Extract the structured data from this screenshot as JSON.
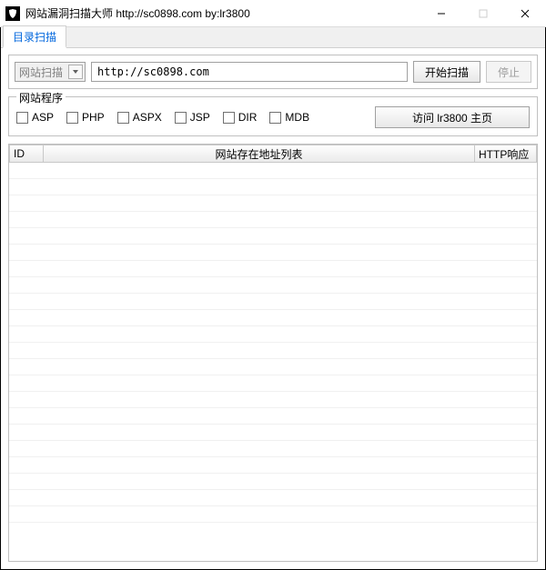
{
  "window": {
    "title": "网站漏洞扫描大师 http://sc0898.com by:lr3800"
  },
  "tab": {
    "label": "目录扫描"
  },
  "scan": {
    "combo_value": "网站扫描",
    "url_value": "http://sc0898.com",
    "start_label": "开始扫描",
    "stop_label": "停止"
  },
  "fieldset": {
    "legend": "网站程序",
    "checks": {
      "asp": "ASP",
      "php": "PHP",
      "aspx": "ASPX",
      "jsp": "JSP",
      "dir": "DIR",
      "mdb": "MDB"
    },
    "visit_label": "访问 lr3800 主页"
  },
  "columns": {
    "id": "ID",
    "addr": "网站存在地址列表",
    "http": "HTTP响应"
  }
}
